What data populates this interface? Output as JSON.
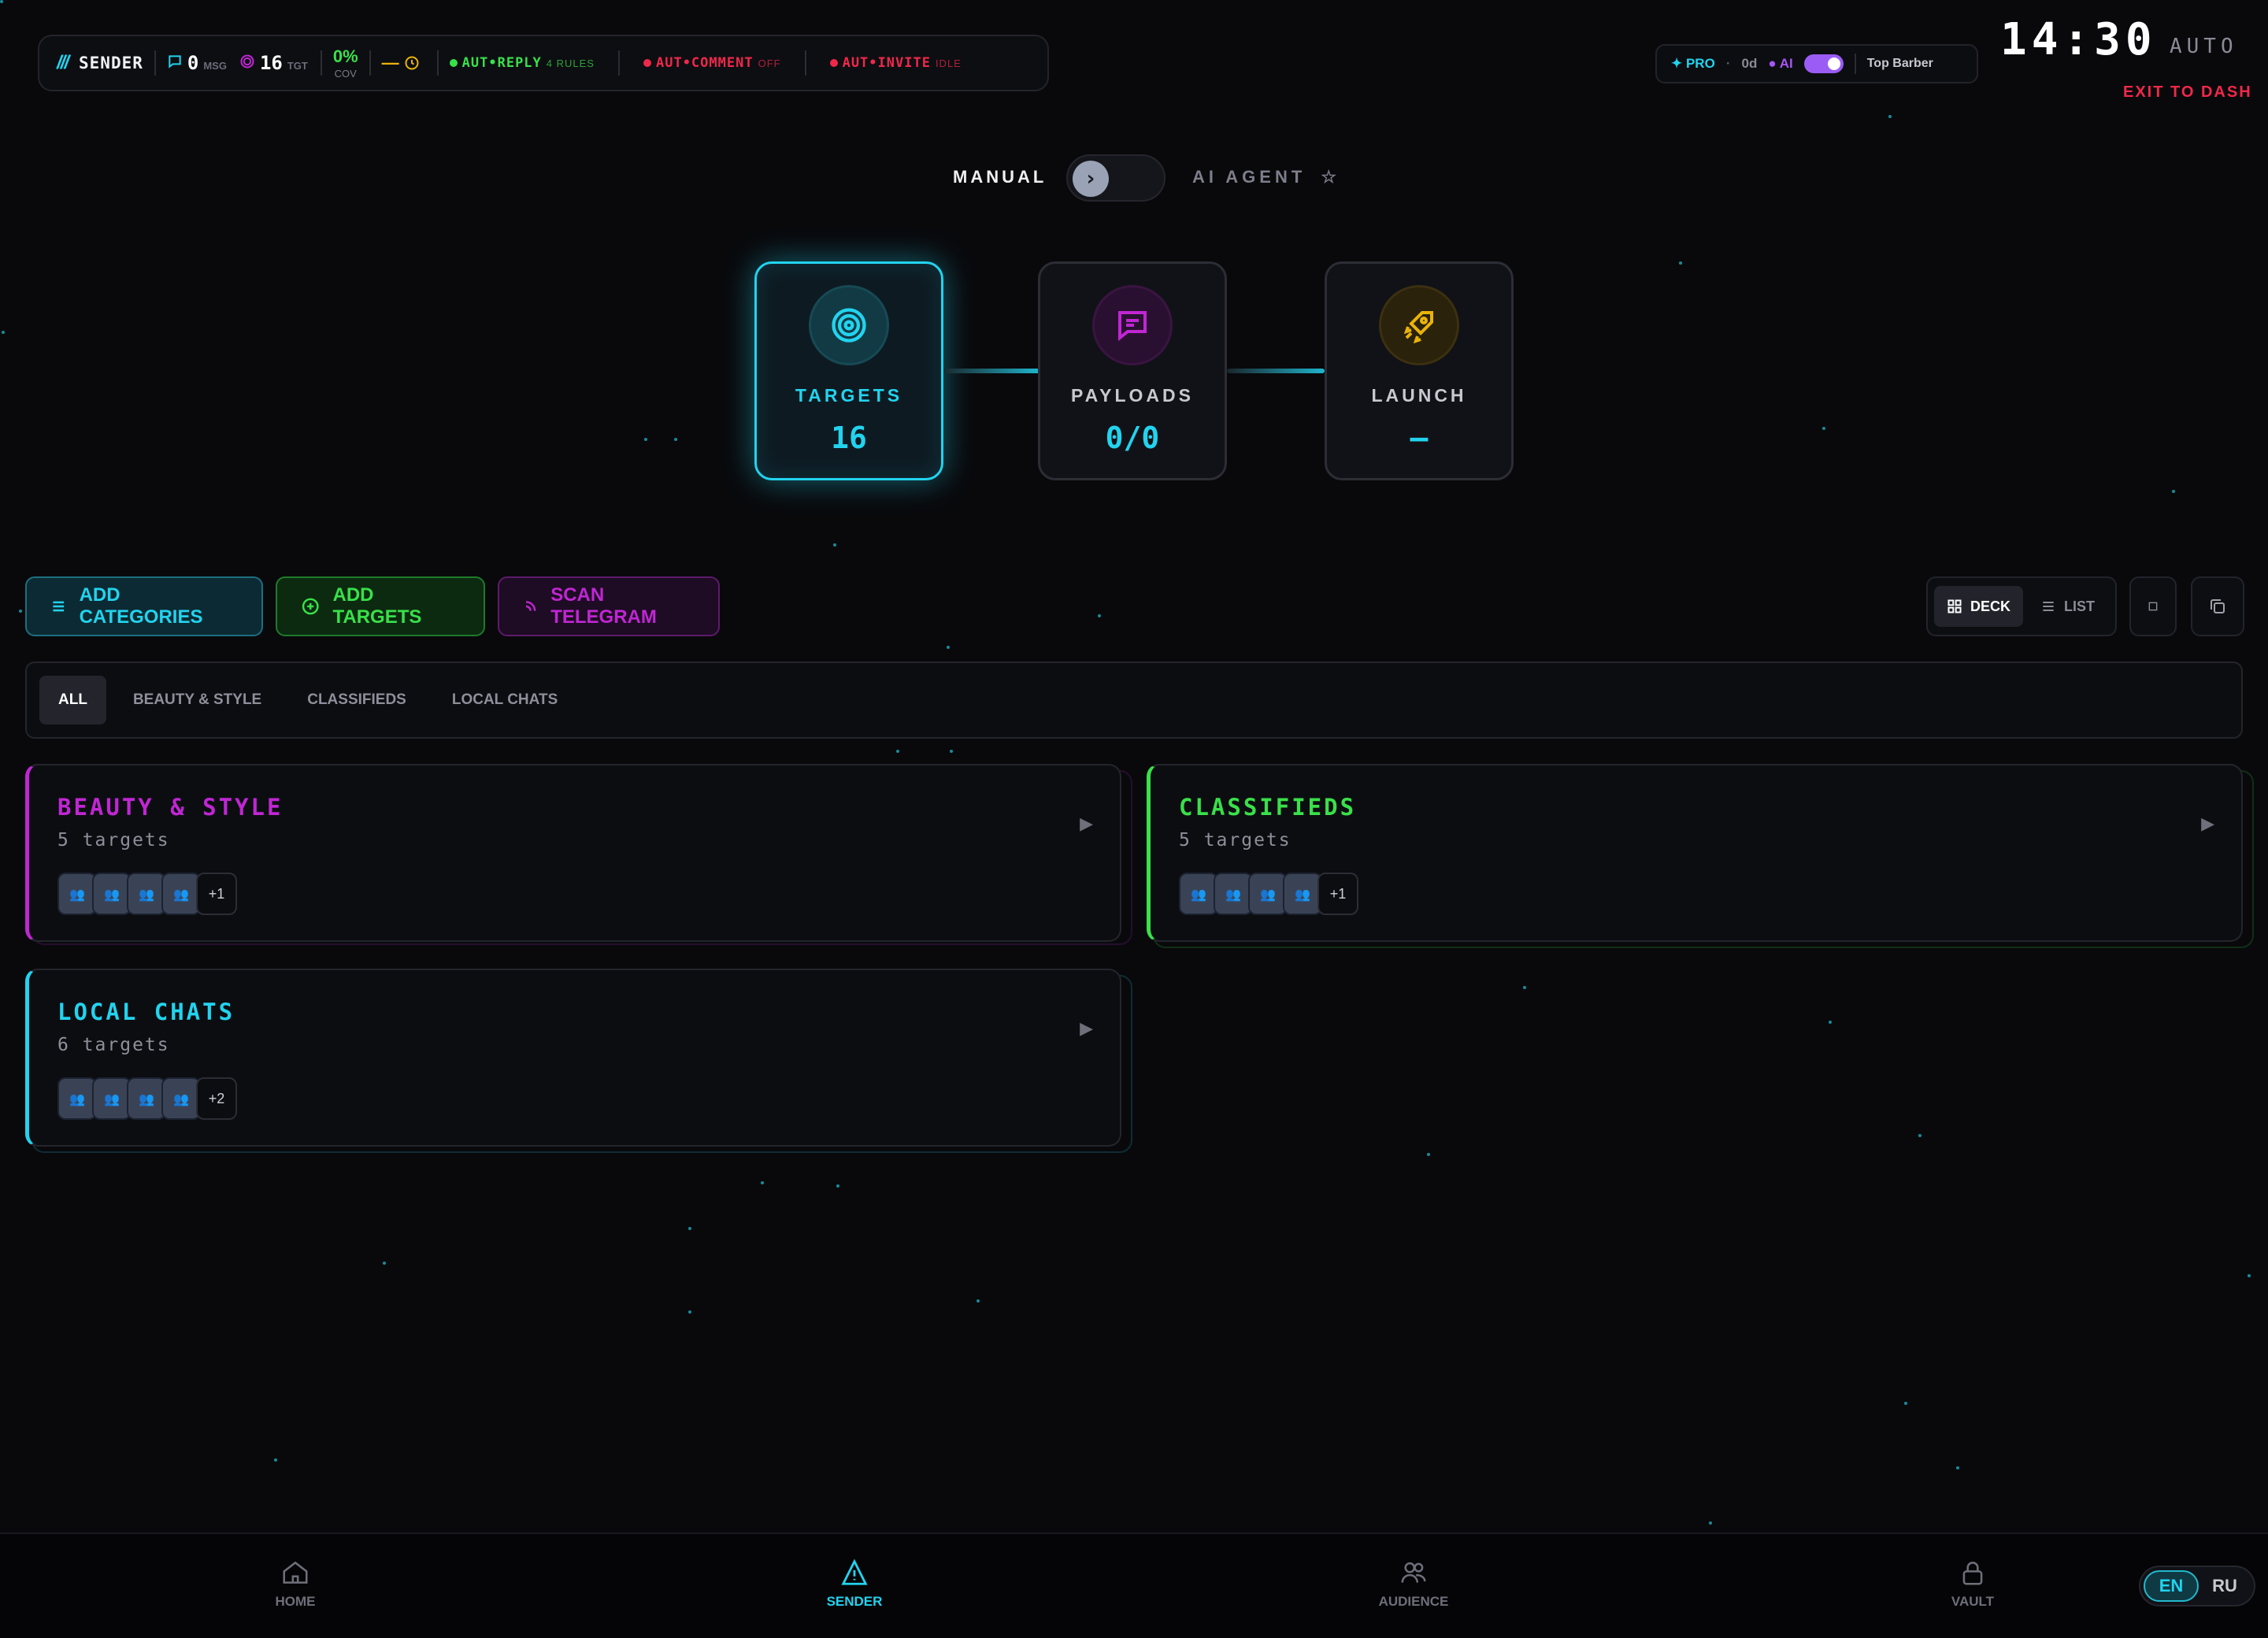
{
  "status_bar": {
    "logo": "///",
    "title": "SENDER",
    "messages": "0",
    "messages_unit": "MSG",
    "targets": "16",
    "targets_unit": "TGT",
    "coverage": "0%",
    "coverage_unit": "COV",
    "timer": "—",
    "automations": [
      {
        "label": "AUT•REPLY",
        "state": "4 RULES",
        "color": "#39e04a"
      },
      {
        "label": "AUT•COMMENT",
        "state": "OFF",
        "color": "#f0284a"
      },
      {
        "label": "AUT•INVITE",
        "state": "IDLE",
        "color": "#f0284a"
      }
    ]
  },
  "pro_bar": {
    "pro_label": "✦ PRO",
    "days": "0d",
    "ai_label": "● AI",
    "ai_enabled": true,
    "account": "Top Barber"
  },
  "clock": "14:30",
  "auto_label": "AUTO",
  "exit_label": "EXIT TO DASH",
  "mode": {
    "manual_label": "MANUAL",
    "ai_label": "AI AGENT",
    "star": "☆"
  },
  "steps": [
    {
      "label": "TARGETS",
      "value": "16",
      "icon": "target-icon",
      "color": "#22d3ee"
    },
    {
      "label": "PAYLOADS",
      "value": "0/0",
      "icon": "message-icon",
      "color": "#c026d3"
    },
    {
      "label": "LAUNCH",
      "value": "—",
      "icon": "rocket-icon",
      "color": "#eab308"
    }
  ],
  "actions": {
    "add_categories": "ADD CATEGORIES",
    "add_targets": "ADD TARGETS",
    "scan_telegram": "SCAN TELEGRAM",
    "deck": "DECK",
    "list": "LIST"
  },
  "tabs": [
    "ALL",
    "BEAUTY & STYLE",
    "CLASSIFIEDS",
    "LOCAL CHATS"
  ],
  "cards": [
    {
      "title": "BEAUTY & STYLE",
      "subtitle": "5 targets",
      "more": "+1",
      "color": "#c026d3"
    },
    {
      "title": "CLASSIFIEDS",
      "subtitle": "5 targets",
      "more": "+1",
      "color": "#39e04a"
    },
    {
      "title": "LOCAL CHATS",
      "subtitle": "6 targets",
      "more": "+2",
      "color": "#22d3ee"
    }
  ],
  "nav": [
    "HOME",
    "SENDER",
    "AUDIENCE",
    "VAULT"
  ],
  "lang": [
    "EN",
    "RU"
  ]
}
